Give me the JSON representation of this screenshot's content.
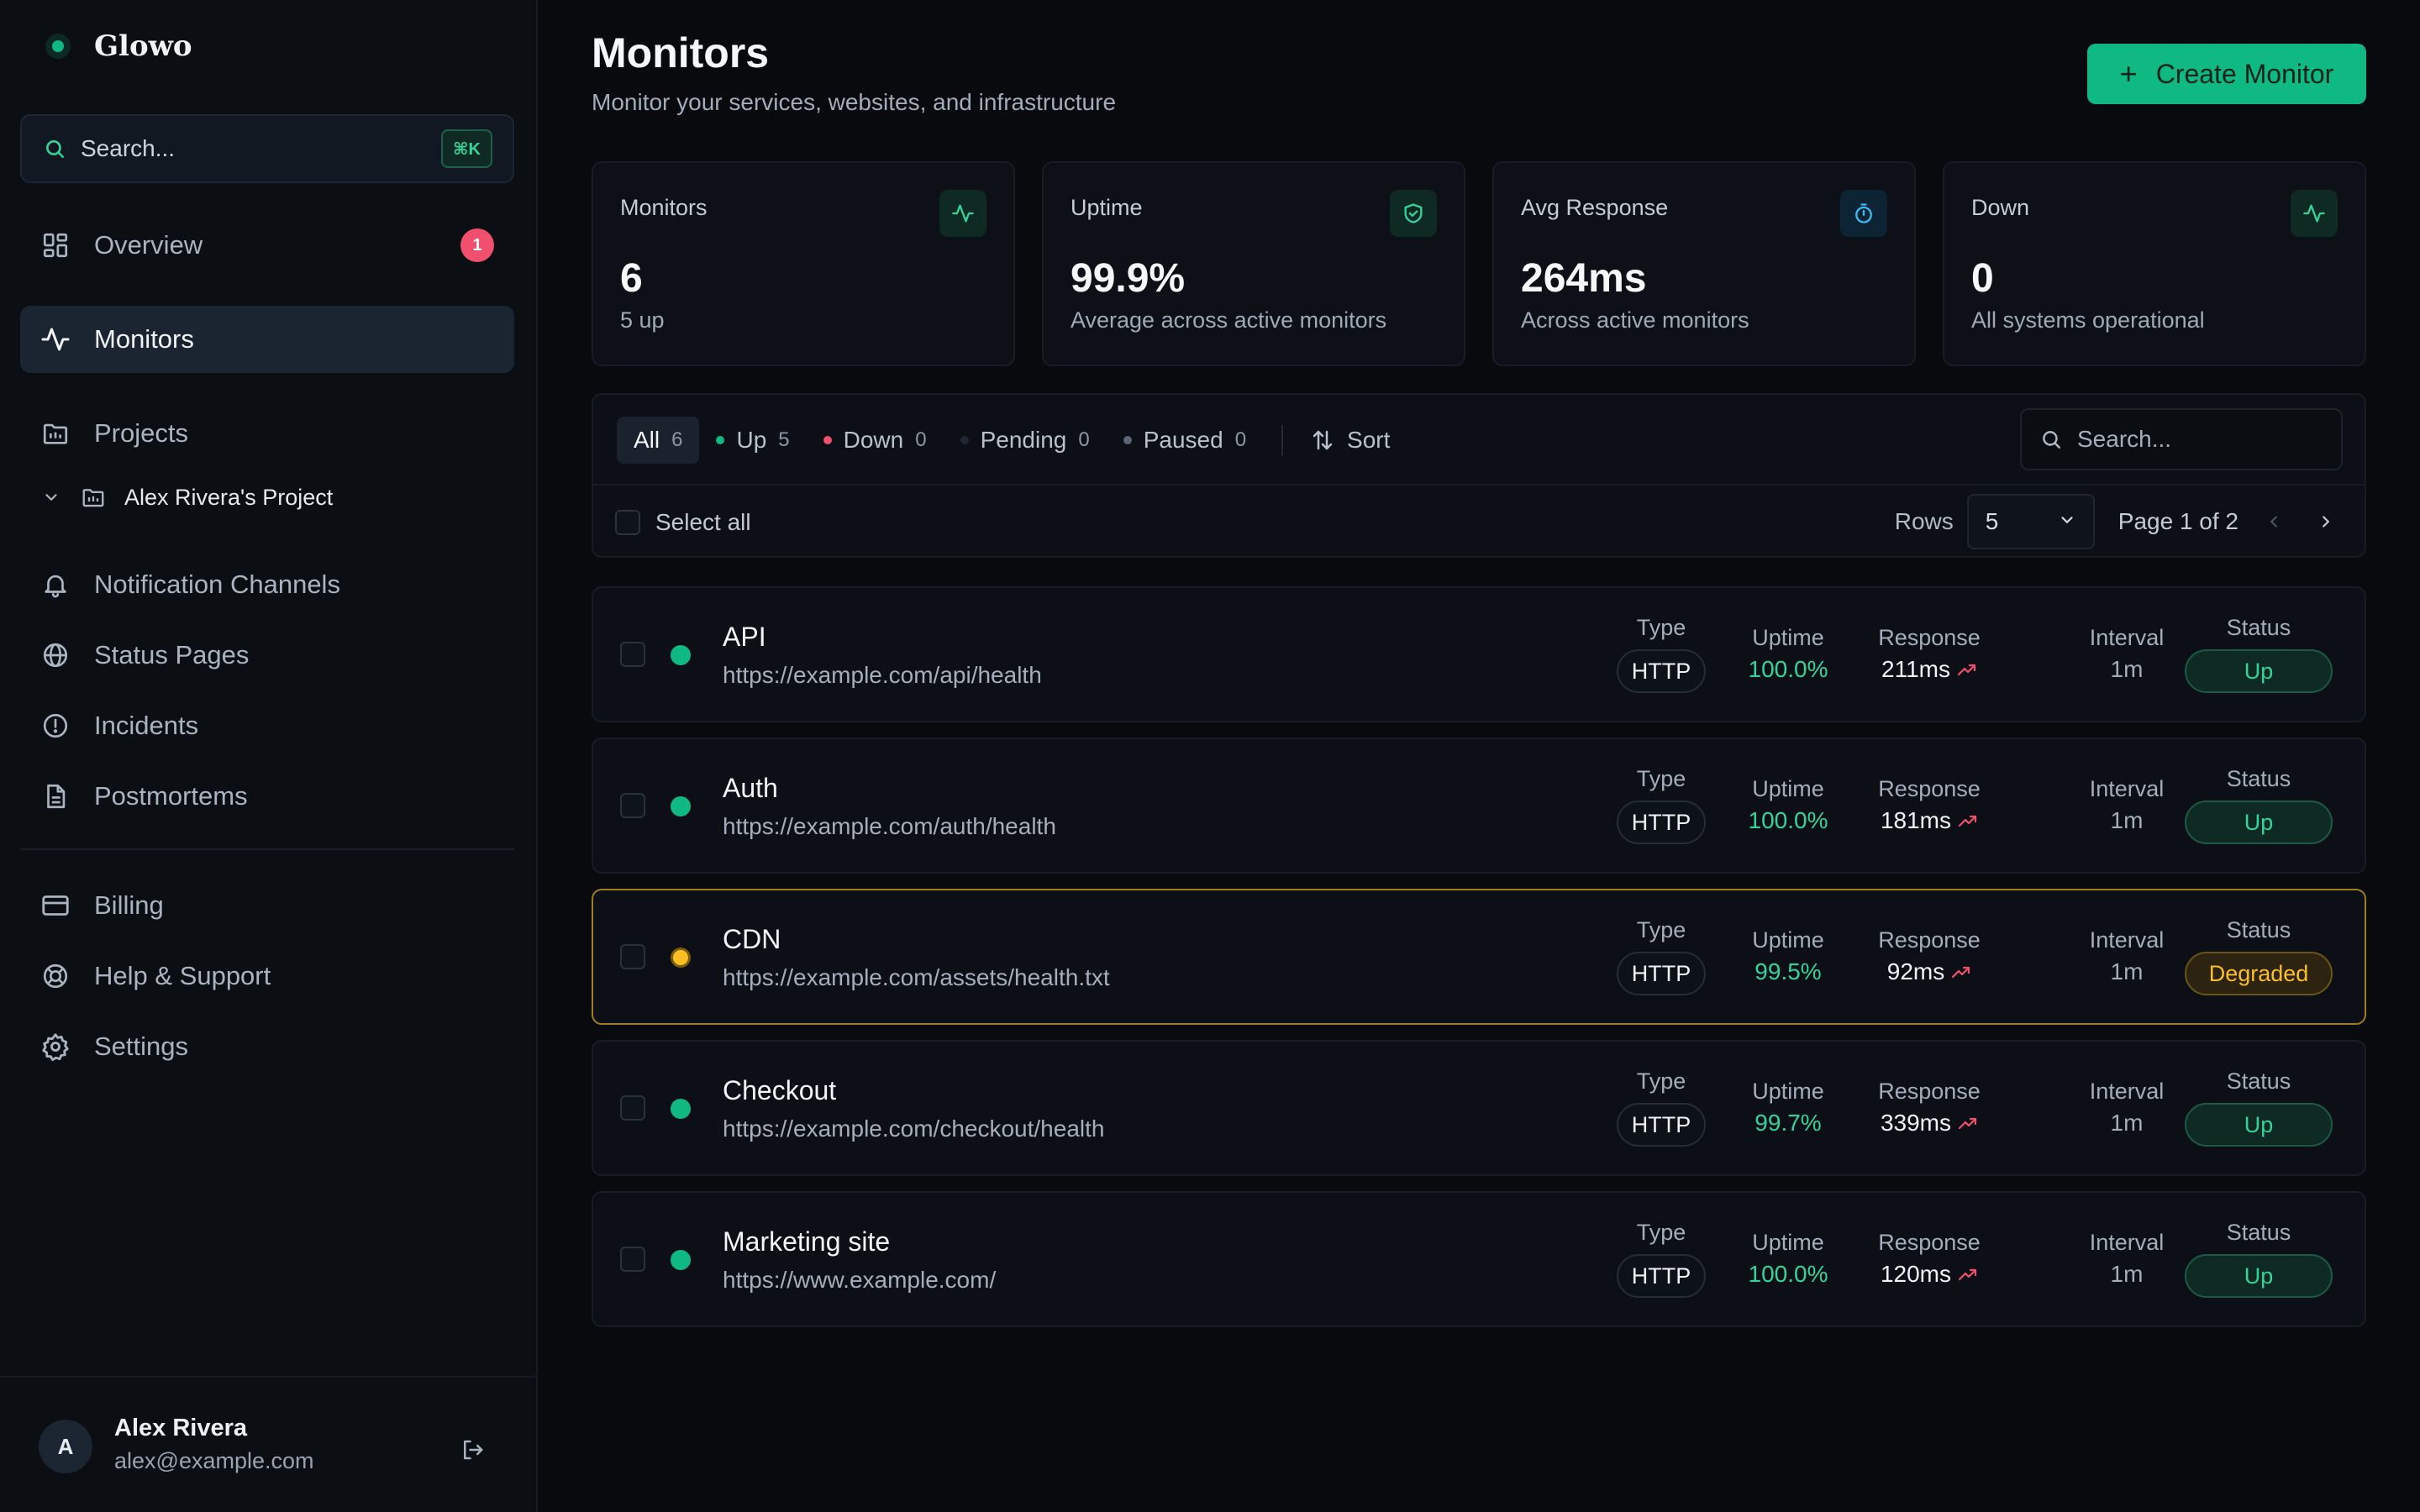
{
  "brand": {
    "name": "Glowo",
    "accent": "#10b981"
  },
  "sidebar": {
    "search_placeholder": "Search...",
    "search_shortcut": "⌘K",
    "items": [
      {
        "label": "Overview",
        "icon": "grid-icon",
        "badge": "1"
      },
      {
        "label": "Monitors",
        "icon": "activity-icon",
        "active": true
      },
      {
        "label": "Projects",
        "icon": "folder-icon"
      },
      {
        "label": "Notification Channels",
        "icon": "bell-icon"
      },
      {
        "label": "Status Pages",
        "icon": "globe-icon"
      },
      {
        "label": "Incidents",
        "icon": "alert-circle-icon"
      },
      {
        "label": "Postmortems",
        "icon": "file-text-icon"
      },
      {
        "label": "Billing",
        "icon": "credit-card-icon"
      },
      {
        "label": "Help & Support",
        "icon": "life-buoy-icon"
      },
      {
        "label": "Settings",
        "icon": "gear-icon"
      }
    ],
    "project": {
      "label": "Alex Rivera's Project"
    }
  },
  "user": {
    "initial": "A",
    "name": "Alex Rivera",
    "email": "alex@example.com"
  },
  "header": {
    "title": "Monitors",
    "subtitle": "Monitor your services, websites, and infrastructure",
    "create_label": "Create Monitor"
  },
  "stats": [
    {
      "label": "Monitors",
      "value": "6",
      "sub": "5 up",
      "icon": "activity-icon"
    },
    {
      "label": "Uptime",
      "value": "99.9%",
      "sub": "Average across active monitors",
      "icon": "shield-check-icon"
    },
    {
      "label": "Avg Response",
      "value": "264ms",
      "sub": "Across active monitors",
      "icon": "timer-icon"
    },
    {
      "label": "Down",
      "value": "0",
      "sub": "All systems operational",
      "icon": "activity-icon"
    }
  ],
  "filters": [
    {
      "label": "All",
      "count": "6",
      "active": true
    },
    {
      "label": "Up",
      "count": "5",
      "color": "#10b981"
    },
    {
      "label": "Down",
      "count": "0",
      "color": "#f0506e"
    },
    {
      "label": "Pending",
      "count": "0",
      "color": "#1f2630"
    },
    {
      "label": "Paused",
      "count": "0",
      "color": "#5b6574"
    }
  ],
  "toolbar": {
    "sort_label": "Sort",
    "search_placeholder": "Search...",
    "select_all_label": "Select all",
    "rows_label": "Rows",
    "rows_value": "5",
    "page_label": "Page 1 of 2"
  },
  "columns": {
    "type": "Type",
    "uptime": "Uptime",
    "response": "Response",
    "interval": "Interval",
    "status": "Status"
  },
  "monitors": [
    {
      "name": "API",
      "url": "https://example.com/api/health",
      "type": "HTTP",
      "uptime": "100.0%",
      "response": "211ms",
      "interval": "1m",
      "status": "Up"
    },
    {
      "name": "Auth",
      "url": "https://example.com/auth/health",
      "type": "HTTP",
      "uptime": "100.0%",
      "response": "181ms",
      "interval": "1m",
      "status": "Up"
    },
    {
      "name": "CDN",
      "url": "https://example.com/assets/health.txt",
      "type": "HTTP",
      "uptime": "99.5%",
      "response": "92ms",
      "interval": "1m",
      "status": "Degraded"
    },
    {
      "name": "Checkout",
      "url": "https://example.com/checkout/health",
      "type": "HTTP",
      "uptime": "99.7%",
      "response": "339ms",
      "interval": "1m",
      "status": "Up"
    },
    {
      "name": "Marketing site",
      "url": "https://www.example.com/",
      "type": "HTTP",
      "uptime": "100.0%",
      "response": "120ms",
      "interval": "1m",
      "status": "Up"
    }
  ],
  "colors": {
    "up": "#10b981",
    "degraded": "#fbbf24",
    "down": "#f0506e",
    "trend": "#f0506e"
  }
}
